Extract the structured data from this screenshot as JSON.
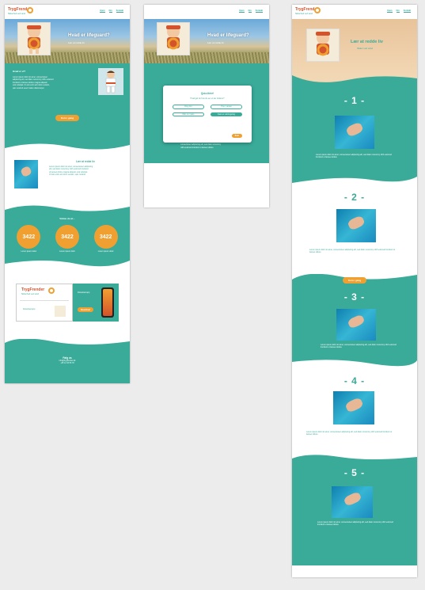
{
  "colors": {
    "teal": "#3aaa99",
    "orange": "#f0a030",
    "brand_red": "#d4532c"
  },
  "brand": {
    "logo_name": "TrygFrender",
    "logo_tagline": "Sikkerhed ved vand",
    "mascot_icon": "lifeguard-mascot-icon"
  },
  "nav": {
    "links": [
      "Hjem",
      "Om",
      "Kontakt"
    ]
  },
  "page1": {
    "hero_title": "Hvad er lifeguard?",
    "hero_subtitle": "Lær at redde liv",
    "question": "Hvad er vi?",
    "body_lines": [
      "Lorem ipsum dolor sit amet, consectetuer",
      "adipiscing elit, sed diam nonummy nibh euismod",
      "tincidunt ut laoreet dolore magna aliquam",
      "erat volutpat. Ut wisi enim ad minim veniam,",
      "quis nostrud exerci tation ullamcorper"
    ],
    "cta": "Kom i gang",
    "section2_title": "Lær at redde liv",
    "section2_lines": [
      "Lorem ipsum dolor sit amet, consectetuer adipiscing",
      "elit, sed diam nonummy nibh euismod tincidunt",
      "ut laoreet dolore magna aliquam erat volutpat.",
      "Ut wisi enim ad minim veniam, quis nostrud"
    ],
    "stats_title": "Vidste du at...",
    "stats": [
      {
        "value": "3422",
        "text": "Lorem ipsum dolor"
      },
      {
        "value": "3422",
        "text": "Lorem ipsum dolor"
      },
      {
        "value": "3422",
        "text": "Lorem ipsum dolor"
      }
    ],
    "app_card_text": "Download app",
    "app_button": "Download",
    "footer_title": "Følg os",
    "footer_lines": [
      "info@trygfrender.dk",
      "+45 12 34 56 78"
    ]
  },
  "page2": {
    "popup_title": "Quiz-time!",
    "popup_question": "Hvad gør du hvis du ser en der drukner?",
    "options": [
      "Ring 112",
      "Hop i vandet",
      "Råb om hjælp",
      "Kast en redningsring"
    ],
    "popup_button": "Svar",
    "body_lines": [
      "Lorem ipsum dolor sit amet,",
      "consectetuer adipiscing elit, sed diam nonummy",
      "nibh euismod tincidunt ut laoreet dolore"
    ]
  },
  "page3": {
    "hero_title": "Lær at redde liv",
    "hero_subtitle": "Sikker ved vand",
    "cta": "Kom i gang",
    "steps": [
      {
        "label": "- 1 -",
        "text": "Lorem ipsum dolor sit amet, consectetuer adipiscing elit, sed diam nonummy nibh euismod tincidunt ut laoreet dolore"
      },
      {
        "label": "- 2 -",
        "text": "Lorem ipsum dolor sit amet, consectetuer adipiscing elit, sed diam nonummy nibh euismod tincidunt ut laoreet dolore"
      },
      {
        "label": "- 3 -",
        "text": "Lorem ipsum dolor sit amet, consectetuer adipiscing elit, sed diam nonummy nibh euismod tincidunt ut laoreet dolore"
      },
      {
        "label": "- 4 -",
        "text": "Lorem ipsum dolor sit amet, consectetuer adipiscing elit, sed diam nonummy nibh euismod tincidunt ut laoreet dolore"
      },
      {
        "label": "- 5 -",
        "text": "Lorem ipsum dolor sit amet, consectetuer adipiscing elit, sed diam nonummy nibh euismod tincidunt ut laoreet dolore"
      }
    ]
  }
}
